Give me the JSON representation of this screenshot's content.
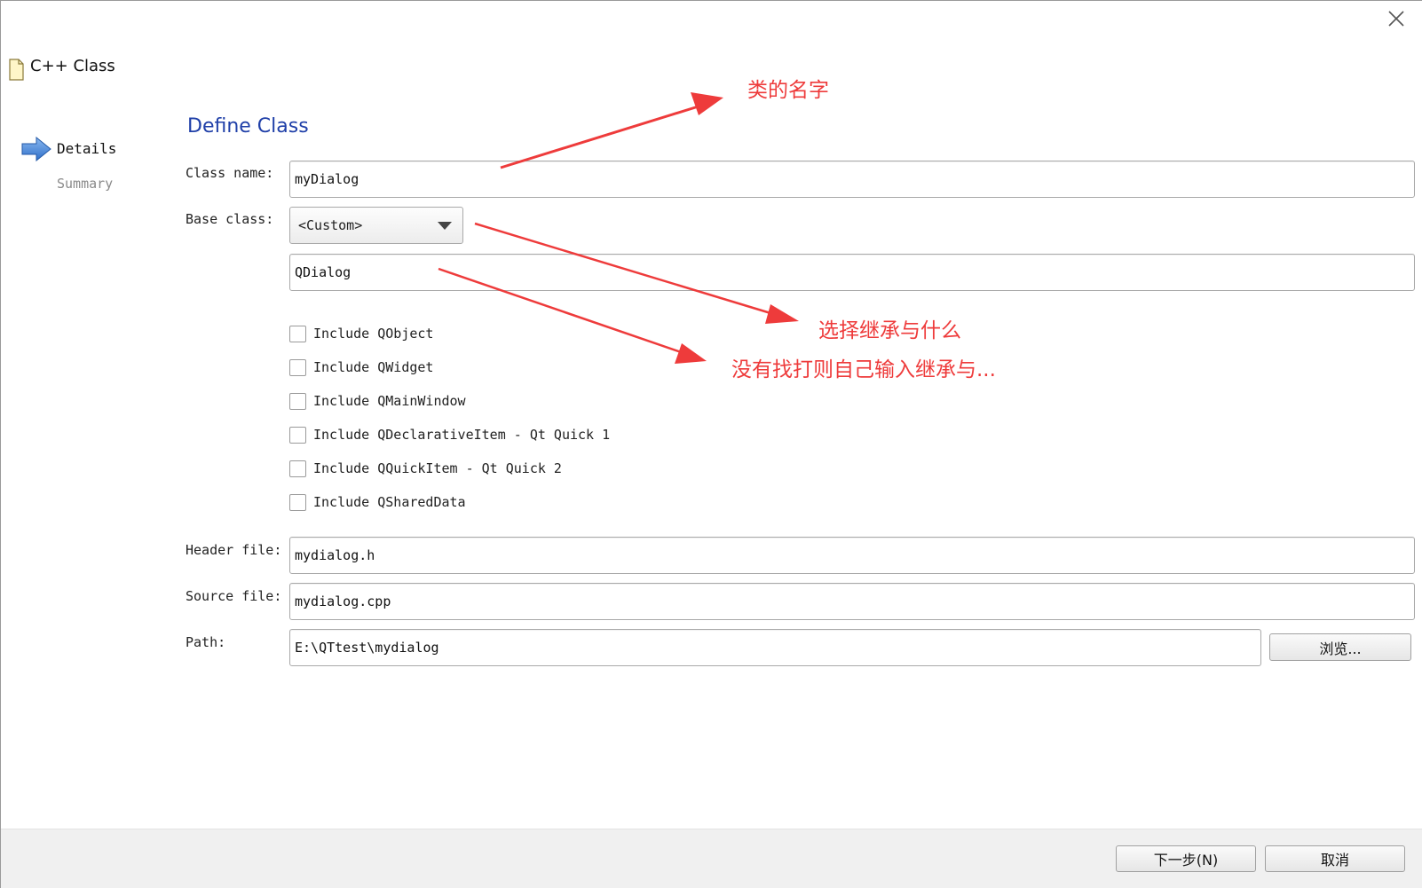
{
  "wizard": {
    "title": "C++ Class",
    "close_icon": "close-icon"
  },
  "sidebar": {
    "steps": [
      {
        "label": "Details",
        "active": true
      },
      {
        "label": "Summary",
        "active": false
      }
    ]
  },
  "page": {
    "title": "Define Class"
  },
  "form": {
    "class_name_label": "Class name:",
    "class_name_value": "myDialog",
    "base_class_label": "Base class:",
    "base_class_selected": "<Custom>",
    "custom_base_value": "QDialog",
    "checkboxes": [
      {
        "label": "Include QObject",
        "checked": false
      },
      {
        "label": "Include QWidget",
        "checked": false
      },
      {
        "label": "Include QMainWindow",
        "checked": false
      },
      {
        "label": "Include QDeclarativeItem - Qt Quick 1",
        "checked": false
      },
      {
        "label": "Include QQuickItem - Qt Quick 2",
        "checked": false
      },
      {
        "label": "Include QSharedData",
        "checked": false
      }
    ],
    "header_file_label": "Header file:",
    "header_file_value": "mydialog.h",
    "source_file_label": "Source file:",
    "source_file_value": "mydialog.cpp",
    "path_label": "Path:",
    "path_value": "E:\\QTtest\\mydialog",
    "browse_label": "浏览..."
  },
  "footer": {
    "next_label": "下一步(N)",
    "cancel_label": "取消"
  },
  "annotations": {
    "class_name_note": "类的名字",
    "base_class_note": "选择继承与什么",
    "custom_note": "没有找打则自己输入继承与...",
    "color": "#ee3b3b"
  },
  "colors": {
    "title_blue": "#1f3fa8",
    "arrow_blue": "#3b7fd9"
  }
}
